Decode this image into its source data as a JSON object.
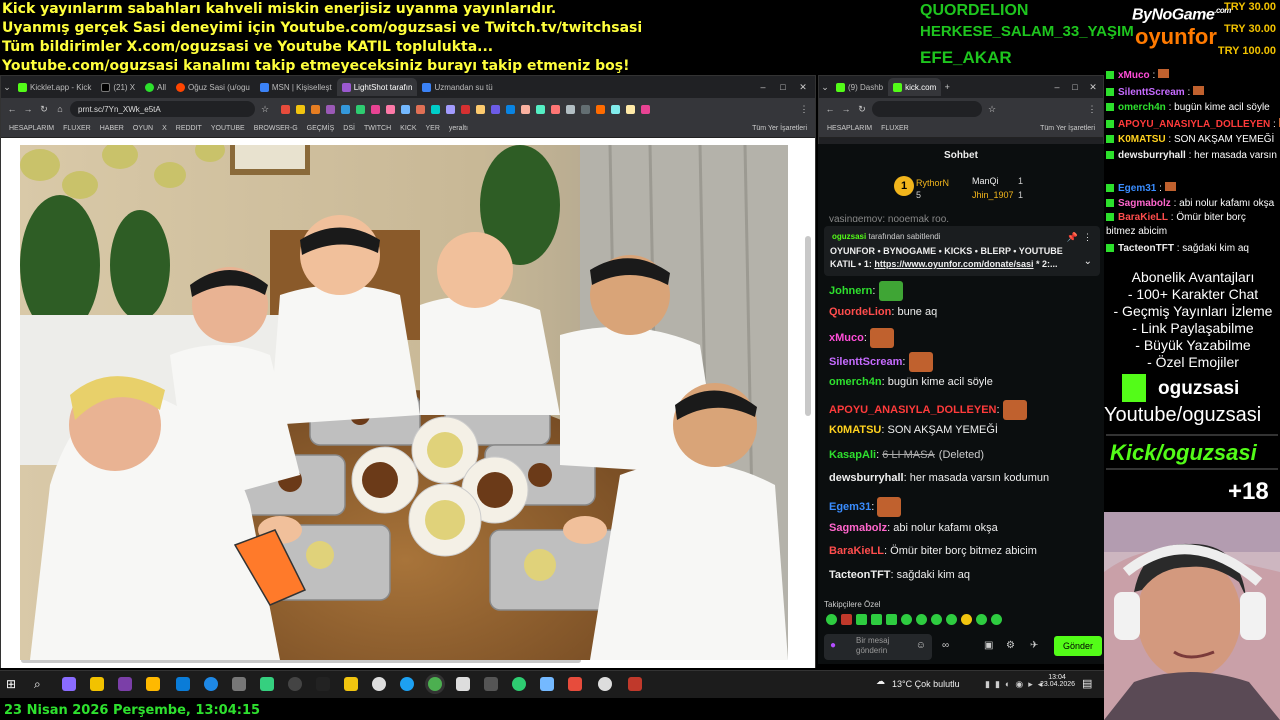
{
  "ticker": [
    "Kick yayınlarım sabahları kahveli miskin enerjisiz uyanma yayınlarıdır.",
    "Uyanmış gerçek Sasi deneyimi için Youtube.com/oguzsasi ve Twitch.tv/twitchsasi",
    "Tüm bildirimler X.com/oguzsasi ve Youtube KATIL toplulukta...",
    "Youtube.com/oguzsasi kanalımı takip etmeyeceksiniz burayı takip etmeniz boş!"
  ],
  "donors": [
    "QUORDELION",
    "HERKESE_SALAM_33_YAŞIM",
    "EFE_AKAR"
  ],
  "brands": {
    "bynogame": "ByNoGame",
    "bynogame_sup": ".com",
    "oyunfor": "oyunfor"
  },
  "donations": [
    "TRY 30.00",
    "TRY 30.00",
    "TRY 100.00"
  ],
  "browser": {
    "tabs": [
      "Kicklet.app - Kick",
      "(21) X",
      "All",
      "Oğuz Sasi (u/ogu",
      "MSN | Kişiselleşt",
      "LightShot tarafın",
      "Uzmandan su tü"
    ],
    "url": "prnt.sc/7Yn_XWk_e5tA",
    "bookmarks": [
      "HESAPLARIM",
      "FLUXER",
      "HABER",
      "OYUN",
      "X",
      "REDDIT",
      "YOUTUBE",
      "BROWSER-G",
      "GEÇMİŞ",
      "DSİ",
      "TWITCH",
      "KICK",
      "YER",
      "yeraltı",
      "Tüm Yer İşaretleri"
    ]
  },
  "chat_browser": {
    "tabs": [
      "(9) Dashb",
      "kick.com"
    ],
    "bookmarks": [
      "HESAPLARIM",
      "FLUXER",
      "Tüm Yer İşaretleri"
    ],
    "title": "Sohbet",
    "leaders": [
      {
        "name": "RythorN",
        "count": "5"
      },
      {
        "name": "ManQi",
        "count": "1"
      },
      {
        "name": "Jhin_1907",
        "count": "1"
      }
    ],
    "cut_line": "yasingemoy: nooemak roo.",
    "pinned_by": "oguzsasi",
    "pinned_suffix": "tarafından sabitlendi",
    "pinned_line1": "OYUNFOR • BYNOGAME • KICKS • BLERP • YOUTUBE",
    "pinned_line2_prefix": "KATIL • 1: ",
    "pinned_link": "https://www.oyunfor.com/donate/sasi",
    "pinned_line2_suffix": " * 2:...",
    "messages": [
      {
        "user": "Johnern",
        "text": "",
        "color": "#2ee02e"
      },
      {
        "user": "QuordeLion",
        "text": "bune aq",
        "color": "#ff4d4d"
      },
      {
        "user": "xMuco",
        "text": "",
        "color": "#ff4dd8"
      },
      {
        "user": "SilenttScream",
        "text": "",
        "color": "#c66bff"
      },
      {
        "user": "omerch4n",
        "text": "bugün kime acil söyle",
        "color": "#2ee02e"
      },
      {
        "user": "APOYU_ANASIYLA_DOLLEYEN",
        "text": "",
        "color": "#ff3b3b"
      },
      {
        "user": "K0MATSU",
        "text": "SON AKŞAM YEMEĞİ",
        "color": "#ffd21f"
      },
      {
        "user": "KasapAli",
        "text": "6 LI MASA",
        "deleted": "(Deleted)",
        "color": "#2ee02e"
      },
      {
        "user": "dewsburryhall",
        "text": "her masada varsın kodumun",
        "color": "#eeeeee"
      },
      {
        "user": "Egem31",
        "text": "",
        "color": "#3a8dff"
      },
      {
        "user": "Sagmabolz",
        "text": "abi nolur kafamı okşa",
        "color": "#ff66cc"
      },
      {
        "user": "BaraKieLL",
        "text": "Ömür biter borç bitmez abicim",
        "color": "#ff4d4d"
      },
      {
        "user": "TacteonTFT",
        "text": "sağdaki kim aq",
        "color": "#eeeeee"
      }
    ],
    "followers_only": "Takipçilere Özel",
    "input_placeholder": "Bir mesaj gönderin",
    "send": "Gönder"
  },
  "side_chat": [
    {
      "user": "xMuco",
      "text": "",
      "color": "#ff4dd8"
    },
    {
      "user": "SilenttScream",
      "text": "",
      "color": "#c66bff"
    },
    {
      "user": "omerch4n",
      "text": "bugün kime acil söyle",
      "color": "#2ee02e"
    },
    {
      "user": "APOYU_ANASIYLA_DOLLEYEN",
      "text": "",
      "color": "#ff3b3b"
    },
    {
      "user": "K0MATSU",
      "text": "SON AKŞAM YEMEĞİ",
      "color": "#ffd21f"
    },
    {
      "user": "dewsburryhall",
      "text": "her masada varsın kodumun",
      "color": "#eeeeee"
    },
    {
      "user": "Egem31",
      "text": "",
      "color": "#3a8dff"
    },
    {
      "user": "Sagmabolz",
      "text": "abi nolur kafamı okşa",
      "color": "#ff66cc"
    },
    {
      "user": "BaraKieLL",
      "text": "Ömür biter borç bitmez abicim",
      "color": "#ff4d4d"
    },
    {
      "user": "TacteonTFT",
      "text": "sağdaki kim aq",
      "color": "#eeeeee"
    }
  ],
  "perks": {
    "title": "Abonelik Avantajları",
    "items": [
      "- 100+ Karakter Chat",
      "- Geçmiş Yayınları İzleme",
      "- Link Paylaşabilme",
      "- Büyük Yazabilme",
      "- Özel Emojiler"
    ]
  },
  "socials": {
    "kick": "oguzsasi",
    "youtube": "Youtube/oguzsasi",
    "kick_url": "Kick/oguzsasi",
    "age": "+18"
  },
  "taskbar": {
    "weather": "13°C  Çok bulutlu",
    "time": "13:04",
    "date": "23.04.2026"
  },
  "clock": "23 Nisan 2026 Perşembe, 13:04:15",
  "colors": {
    "kick_green": "#53fc18",
    "ticker": "#ffff3c"
  }
}
